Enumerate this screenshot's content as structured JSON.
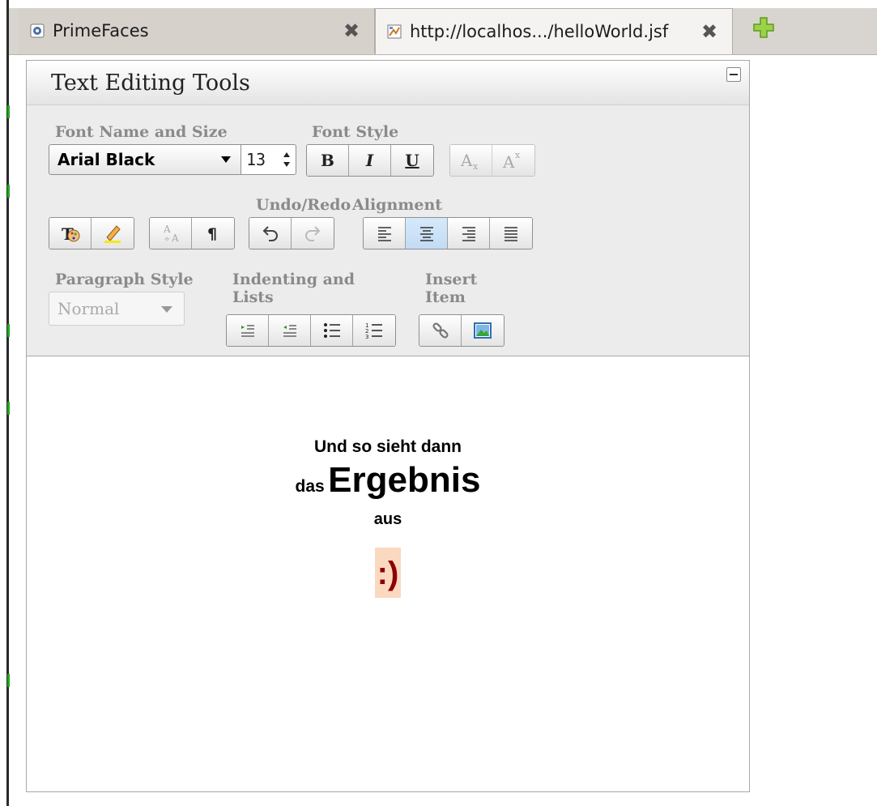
{
  "browser": {
    "tabs": [
      {
        "label": "PrimeFaces",
        "active": false
      },
      {
        "label": "http://localhos.../helloWorld.jsf",
        "active": true
      }
    ]
  },
  "panel": {
    "title": "Text Editing Tools"
  },
  "toolbar": {
    "font_group_label": "Font Name and Size",
    "font_name": "Arial Black",
    "font_size": "13",
    "font_style_label": "Font Style",
    "bold_label": "B",
    "italic_label": "I",
    "underline_label": "U",
    "undo_redo_label": "Undo/Redo",
    "alignment_label": "Alignment",
    "paragraph_style_label": "Paragraph Style",
    "paragraph_style_value": "Normal",
    "indenting_label": "Indenting and Lists",
    "insert_label": "Insert Item"
  },
  "content": {
    "line1": "Und so sieht dann",
    "line2_small": "das",
    "line2_big": "Ergebnis",
    "line3": "aus",
    "smiley": ":)"
  },
  "colors": {
    "smiley_text": "#8b0000",
    "smiley_highlight": "#fbd8c0",
    "selected_button": "#c2dcf4"
  }
}
